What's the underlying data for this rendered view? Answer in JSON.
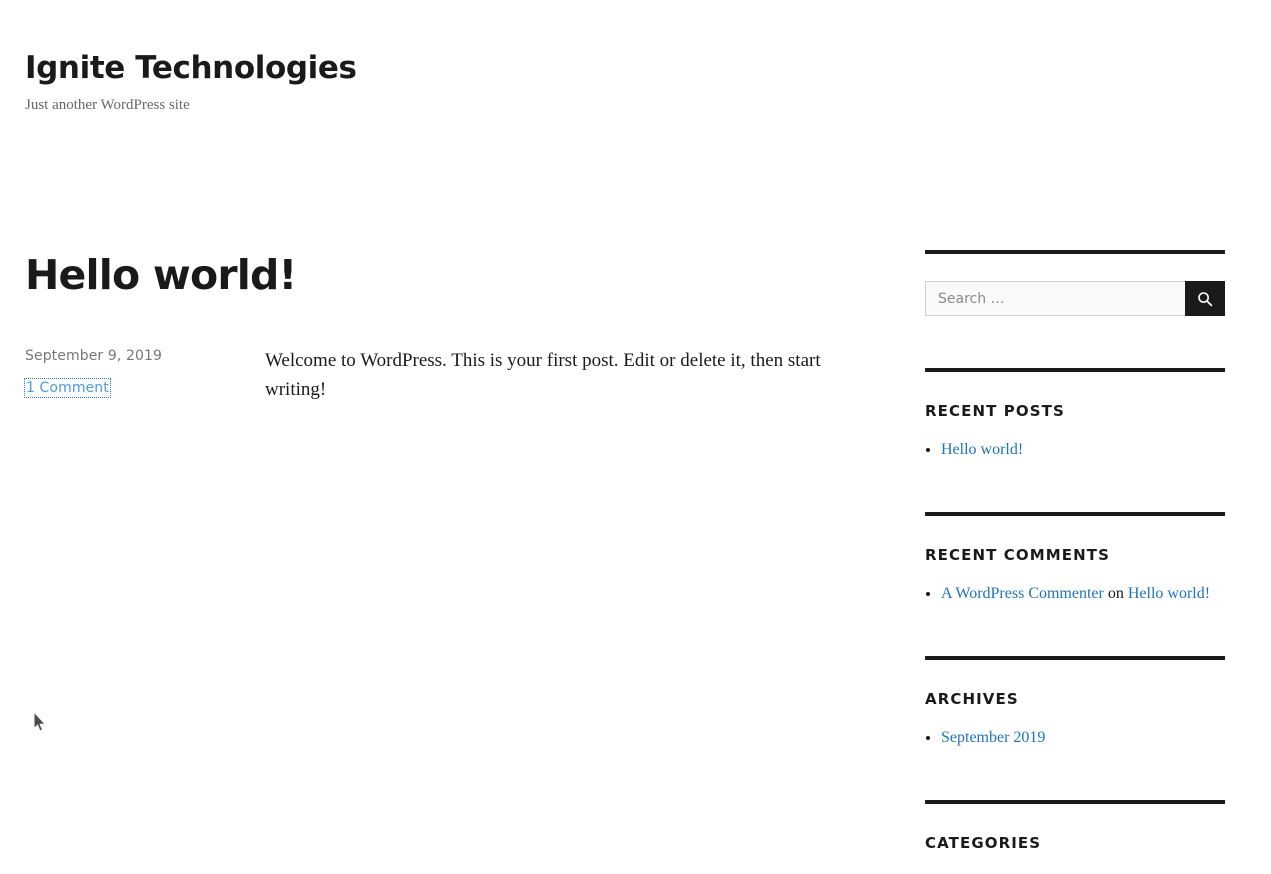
{
  "site": {
    "title": "Ignite Technologies",
    "description": "Just another WordPress site"
  },
  "post": {
    "title": "Hello world!",
    "date": "September 9, 2019",
    "comments_label": "1 Comment",
    "body": "Welcome to WordPress. This is your first post. Edit or delete it, then start writing!"
  },
  "sidebar": {
    "search": {
      "placeholder": "Search …",
      "value": "",
      "submit_icon": "search-icon"
    },
    "recent_posts": {
      "title": "Recent Posts",
      "items": [
        {
          "label": "Hello world!"
        }
      ]
    },
    "recent_comments": {
      "title": "Recent Comments",
      "items": [
        {
          "author": "A WordPress Commenter",
          "separator": "on",
          "target": "Hello world!"
        }
      ]
    },
    "archives": {
      "title": "Archives",
      "items": [
        {
          "label": "September 2019"
        }
      ]
    },
    "categories": {
      "title": "Categories",
      "items": []
    }
  },
  "colors": {
    "link": "#1e73be",
    "focus_link": "#4a9ae0",
    "text": "#1a1a1a",
    "muted": "#767676",
    "rule": "#1a1a1a",
    "button": "#1a1a1a"
  }
}
